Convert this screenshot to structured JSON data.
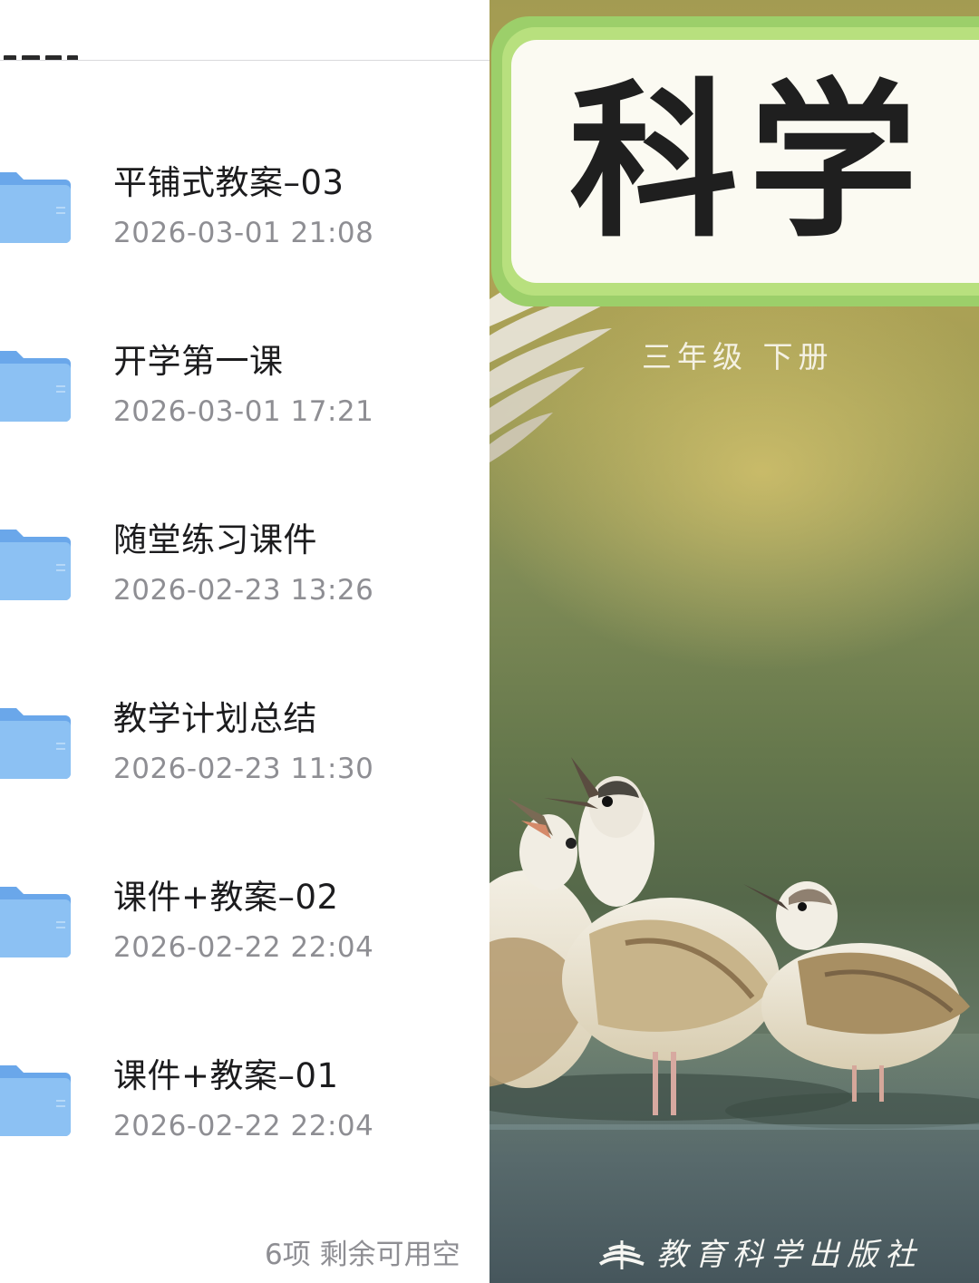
{
  "file_list": {
    "items": [
      {
        "name": "平铺式教案–03",
        "date": "2026-03-01 21:08"
      },
      {
        "name": "开学第一课",
        "date": "2026-03-01 17:21"
      },
      {
        "name": "随堂练习课件",
        "date": "2026-02-23 13:26"
      },
      {
        "name": "教学计划总结",
        "date": "2026-02-23 11:30"
      },
      {
        "name": "课件+教案–02",
        "date": "2026-02-22 22:04"
      },
      {
        "name": "课件+教案–01",
        "date": "2026-02-22 22:04"
      }
    ],
    "footer_status": "6项 剩余可用空",
    "folder_icon": "folder-icon",
    "folder_color": "#7fb6ee"
  },
  "cover": {
    "title": "科学",
    "grade": "三年级 下册",
    "publisher": "教育科学出版社",
    "frame_color": "#9ccf6a"
  }
}
